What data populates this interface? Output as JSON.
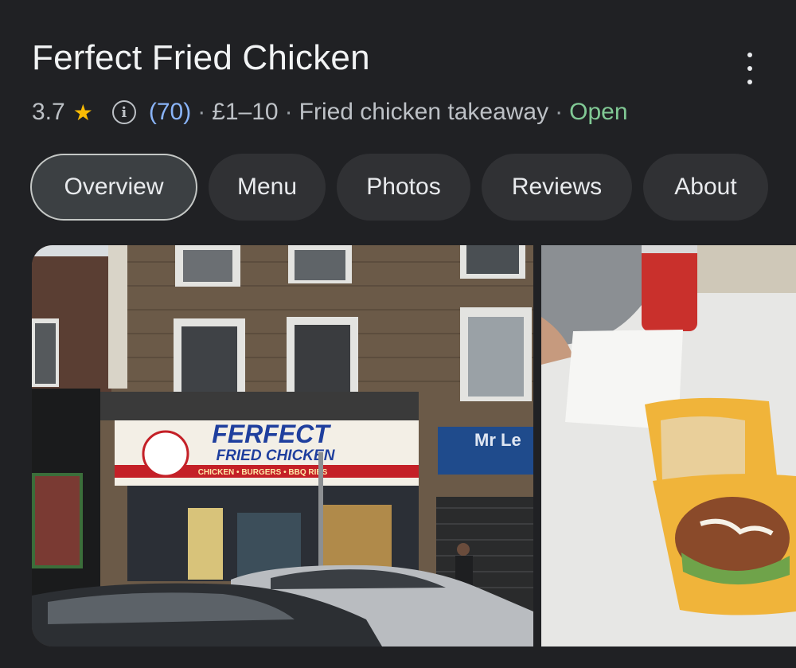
{
  "place": {
    "title": "Ferfect Fried Chicken",
    "rating": "3.7",
    "star_icon": "star-icon",
    "info_icon": "info-icon",
    "review_count": "(70)",
    "price": "£1–10",
    "category": "Fried chicken takeaway",
    "status": "Open",
    "separator": "·",
    "colors": {
      "open": "#81c995",
      "count": "#8ab4f8",
      "star": "#fbbc04"
    }
  },
  "menu_icon": "more-vert-icon",
  "tabs": [
    {
      "label": "Overview",
      "active": true
    },
    {
      "label": "Menu"
    },
    {
      "label": "Photos"
    },
    {
      "label": "Reviews"
    },
    {
      "label": "About"
    }
  ],
  "photos": {
    "main": {
      "sign_line1": "FERFECT",
      "sign_line2": "FRIED CHICKEN",
      "sign_line3": "CHICKEN • BURGERS • BBQ RIBS",
      "neighbor_sign": "Mr Le"
    },
    "side": {}
  }
}
